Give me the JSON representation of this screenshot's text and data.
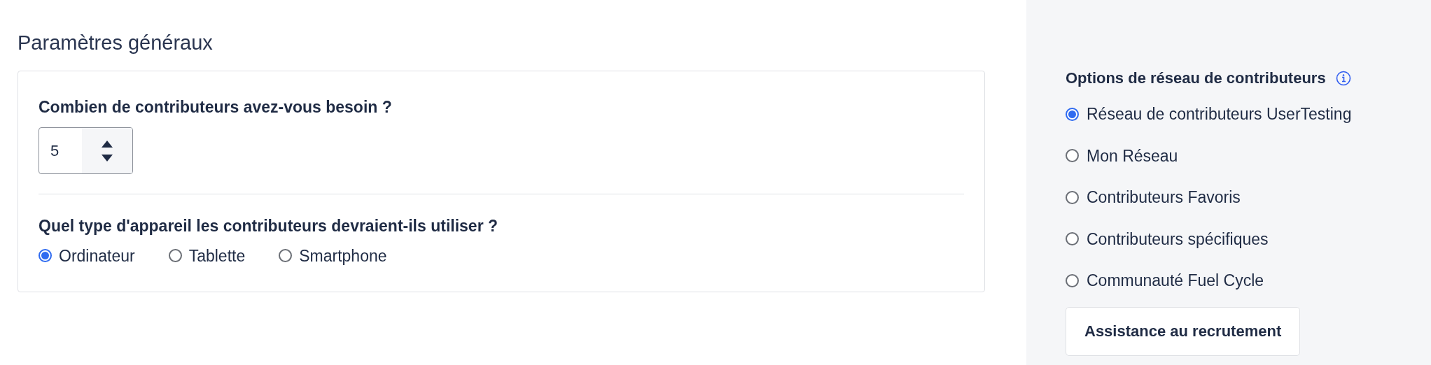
{
  "main": {
    "title": "Paramètres généraux",
    "count_question": "Combien de contributeurs avez-vous besoin ?",
    "count_value": "5",
    "device_question": "Quel type d'appareil les contributeurs devraient-ils utiliser ?",
    "devices": [
      {
        "label": "Ordinateur",
        "selected": true
      },
      {
        "label": "Tablette",
        "selected": false
      },
      {
        "label": "Smartphone",
        "selected": false
      }
    ]
  },
  "sidebar": {
    "title": "Options de réseau de contributeurs",
    "options": [
      {
        "label": "Réseau de contributeurs UserTesting",
        "selected": true
      },
      {
        "label": "Mon Réseau",
        "selected": false
      },
      {
        "label": "Contributeurs Favoris",
        "selected": false
      },
      {
        "label": "Contributeurs spécifiques",
        "selected": false
      },
      {
        "label": "Communauté Fuel Cycle",
        "selected": false
      }
    ],
    "button": "Assistance au recrutement"
  }
}
